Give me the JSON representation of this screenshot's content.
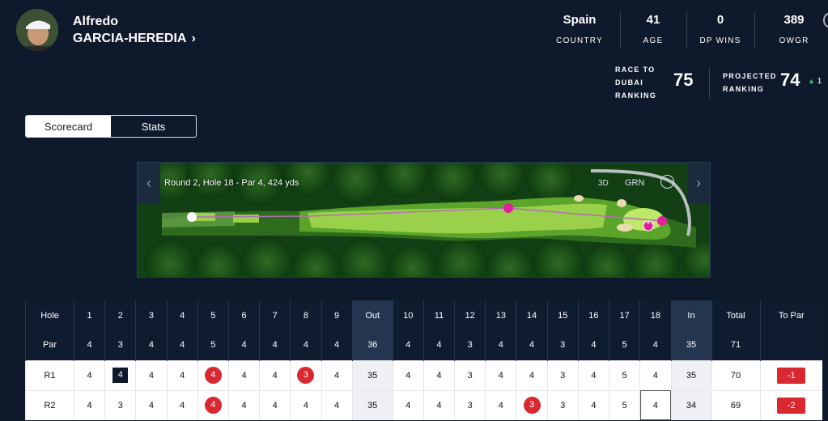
{
  "player": {
    "first_name": "Alfredo",
    "last_name": "GARCIA-HEREDIA",
    "chevron": "›"
  },
  "stats": [
    {
      "value": "Spain",
      "label": "COUNTRY"
    },
    {
      "value": "41",
      "label": "AGE"
    },
    {
      "value": "0",
      "label": "DP WINS"
    },
    {
      "value": "389",
      "label": "OWGR"
    }
  ],
  "race_to_dubai": {
    "label_lines": [
      "RACE TO",
      "DUBAI",
      "RANKING"
    ],
    "value": "75"
  },
  "projected": {
    "label_lines": [
      "PROJECTED",
      "RANKING"
    ],
    "value": "74",
    "change": "1",
    "change_icon": "triangle-up-icon"
  },
  "tabs": [
    {
      "label": "Scorecard",
      "active": true
    },
    {
      "label": "Stats",
      "active": false
    }
  ],
  "hole_map": {
    "caption": "Round 2, Hole 18 - Par 4, 424 yds",
    "view_3d": "3D",
    "view_green": "GRN",
    "shot_marker": "4",
    "prev_icon": "chevron-left-icon",
    "next_icon": "chevron-right-icon",
    "reset_icon": "reset-view-icon"
  },
  "scorecard": {
    "header": [
      "Hole",
      "1",
      "2",
      "3",
      "4",
      "5",
      "6",
      "7",
      "8",
      "9",
      "Out",
      "10",
      "11",
      "12",
      "13",
      "14",
      "15",
      "16",
      "17",
      "18",
      "In",
      "Total",
      "To Par"
    ],
    "par": [
      "Par",
      "4",
      "3",
      "4",
      "4",
      "5",
      "4",
      "4",
      "4",
      "4",
      "36",
      "4",
      "4",
      "3",
      "4",
      "4",
      "3",
      "4",
      "5",
      "4",
      "35",
      "71",
      ""
    ],
    "rounds": [
      {
        "cells": [
          "R1",
          "4",
          "4",
          "4",
          "4",
          "4",
          "4",
          "4",
          "3",
          "4",
          "35",
          "4",
          "4",
          "3",
          "4",
          "4",
          "3",
          "4",
          "5",
          "4",
          "35",
          "70",
          "-1"
        ],
        "marks": {
          "2": "bogey",
          "5": "birdie",
          "8": "birdie"
        }
      },
      {
        "cells": [
          "R2",
          "4",
          "3",
          "4",
          "4",
          "4",
          "4",
          "4",
          "4",
          "4",
          "35",
          "4",
          "4",
          "3",
          "4",
          "3",
          "3",
          "4",
          "5",
          "4",
          "34",
          "69",
          "-2"
        ],
        "marks": {
          "5": "birdie",
          "15": "birdie",
          "19": "box"
        }
      }
    ]
  },
  "colors": {
    "background": "#0e1a2c",
    "birdie": "#d9282f",
    "bogey": "#0e1a2c",
    "up_arrow": "#3fbf5a",
    "pin": "#e3219f"
  }
}
